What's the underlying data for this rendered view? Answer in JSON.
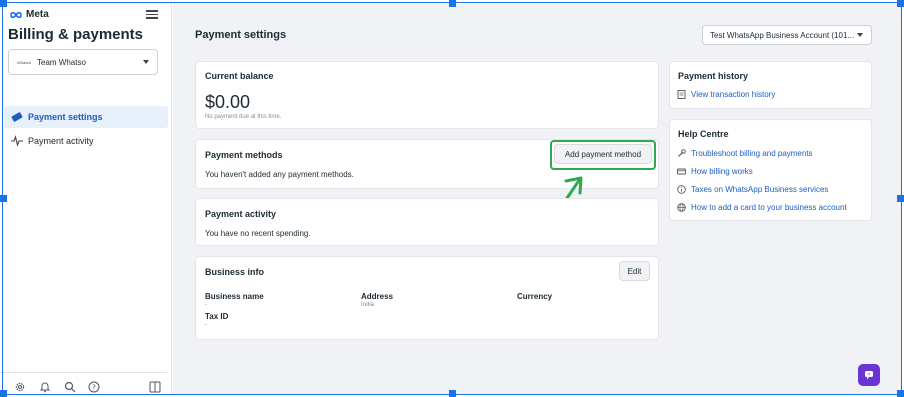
{
  "brand": {
    "logo_text": "Meta"
  },
  "sidebar": {
    "title": "Billing & payments",
    "account_select": {
      "logo_text": "WhatsA",
      "value": "Team Whatso"
    },
    "items": [
      {
        "label": "Payment settings",
        "icon": "payment-card-icon",
        "active": true
      },
      {
        "label": "Payment activity",
        "icon": "activity-pulse-icon",
        "active": false
      }
    ],
    "footer_icons": [
      "gear-icon",
      "bell-icon",
      "search-icon",
      "help-icon",
      "panel-toggle-icon"
    ]
  },
  "header": {
    "title": "Payment settings",
    "business_account_select": "Test WhatsApp Business Account (101..."
  },
  "current_balance": {
    "title": "Current balance",
    "amount": "$0.00",
    "note": "No payment due at this time."
  },
  "payment_methods": {
    "title": "Payment methods",
    "add_button": "Add payment method",
    "empty_text": "You haven't added any payment methods."
  },
  "payment_activity": {
    "title": "Payment activity",
    "empty_text": "You have no recent spending."
  },
  "business_info": {
    "title": "Business info",
    "edit_button": "Edit",
    "fields": {
      "business_name": {
        "label": "Business name",
        "value": "-"
      },
      "address": {
        "label": "Address",
        "value": "India"
      },
      "currency": {
        "label": "Currency",
        "value": ""
      },
      "tax_id": {
        "label": "Tax ID",
        "value": "-"
      }
    }
  },
  "payment_history": {
    "title": "Payment history",
    "link": "View transaction history"
  },
  "help_centre": {
    "title": "Help Centre",
    "links": [
      {
        "label": "Troubleshoot billing and payments",
        "icon": "wrench-icon"
      },
      {
        "label": "How billing works",
        "icon": "card-icon"
      },
      {
        "label": "Taxes on WhatsApp Business services",
        "icon": "info-icon"
      },
      {
        "label": "How to add a card to your business account",
        "icon": "globe-icon"
      }
    ]
  },
  "colors": {
    "accent": "#1d5fbf",
    "highlight": "#2fa84f",
    "chat_button": "#6a34d4",
    "selection": "#1a73e8"
  }
}
